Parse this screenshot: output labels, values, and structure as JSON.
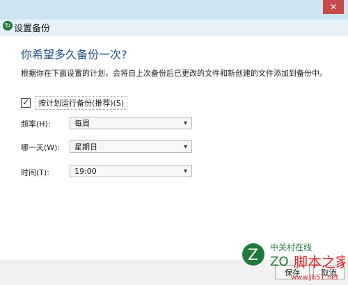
{
  "window": {
    "title": "设置备份",
    "close_glyph": "✕"
  },
  "main": {
    "heading": "你希望多久备份一次?",
    "description": "根据你在下面设置的计划，会将自上次备份后已更改的文件和新创建的文件添加到备份中。"
  },
  "schedule": {
    "checkbox_label": "按计划运行备份(推荐)(S)",
    "checked": true,
    "frequency_label": "频率(H):",
    "frequency_value": "每周",
    "day_label": "哪一天(W):",
    "day_value": "星期日",
    "time_label": "时间(T):",
    "time_value": "19:00"
  },
  "footer": {
    "ok_label": "保存",
    "cancel_label": "取消"
  },
  "watermark": {
    "brand_cn": "中关村在线",
    "brand_short": "ZO",
    "site_cn": "脚本之家",
    "site_url": "www.jb51.net"
  },
  "colors": {
    "heading": "#1d4f86",
    "title_bar": "#e6f1f9",
    "accent_green": "#1f7a3b",
    "watermark_red": "#d22"
  },
  "icons": {
    "title_icon": "backup-icon",
    "checkbox_check": "check-icon",
    "dropdown": "chevron-down-icon"
  }
}
